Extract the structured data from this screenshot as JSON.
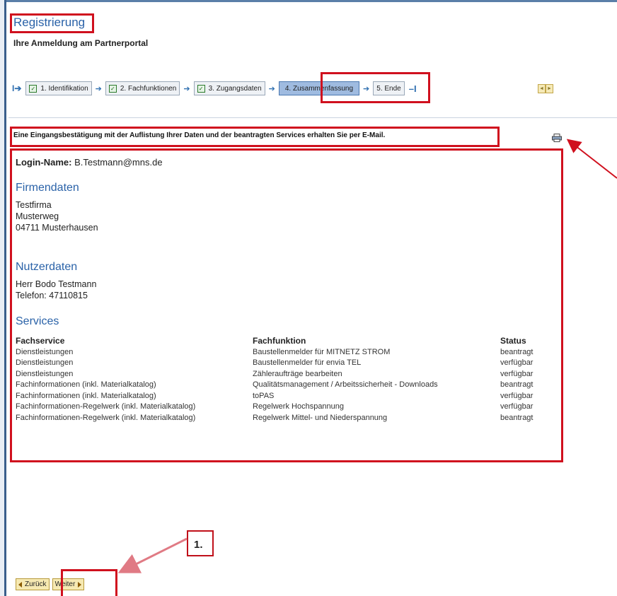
{
  "page": {
    "title": "Registrierung",
    "subtitle": "Ihre Anmeldung am Partnerportal"
  },
  "roadmap": {
    "steps": [
      {
        "label": "1. Identifikation",
        "state": "done"
      },
      {
        "label": "2. Fachfunktionen",
        "state": "done"
      },
      {
        "label": "3. Zugangsdaten",
        "state": "done"
      },
      {
        "label": "4. Zusammenfassung",
        "state": "active"
      },
      {
        "label": "5. Ende",
        "state": "pending"
      }
    ],
    "check_mark": "✓",
    "nav_prev": "◄",
    "nav_next": "►"
  },
  "notice": "Eine Eingangsbestätigung mit der Auflistung Ihrer Daten und der beantragten Services erhalten Sie per E-Mail.",
  "print_icon": "printer-icon",
  "summary": {
    "login_label": "Login-Name:",
    "login_value": "B.Testmann@mns.de",
    "firma_heading": "Firmendaten",
    "firma_lines": [
      "Testfirma",
      "Musterweg",
      "04711 Musterhausen"
    ],
    "nutzer_heading": "Nutzerdaten",
    "nutzer_lines": [
      "Herr Bodo Testmann",
      "Telefon: 47110815"
    ],
    "services_heading": "Services",
    "services_columns": [
      "Fachservice",
      "Fachfunktion",
      "Status"
    ],
    "services_rows": [
      [
        "Dienstleistungen",
        "Baustellenmelder für MITNETZ STROM",
        "beantragt"
      ],
      [
        "Dienstleistungen",
        "Baustellenmelder für envia TEL",
        "verfügbar"
      ],
      [
        "Dienstleistungen",
        "Zähleraufträge bearbeiten",
        "verfügbar"
      ],
      [
        "Fachinformationen (inkl. Materialkatalog)",
        "Qualitätsmanagement / Arbeitssicherheit - Downloads",
        "beantragt"
      ],
      [
        "Fachinformationen (inkl. Materialkatalog)",
        "toPAS",
        "verfügbar"
      ],
      [
        "Fachinformationen-Regelwerk (inkl. Materialkatalog)",
        "Regelwerk Hochspannung",
        "verfügbar"
      ],
      [
        "Fachinformationen-Regelwerk (inkl. Materialkatalog)",
        "Regelwerk Mittel- und Niederspannung",
        "beantragt"
      ]
    ]
  },
  "buttons": {
    "back": "Zurück",
    "next": "Weiter"
  },
  "annotation": {
    "callout_label": "1."
  },
  "colors": {
    "highlight": "#d0101e",
    "heading_blue": "#2a62a8",
    "active_step": "#9fbbe0",
    "button_bg": "#f6e9b2"
  }
}
